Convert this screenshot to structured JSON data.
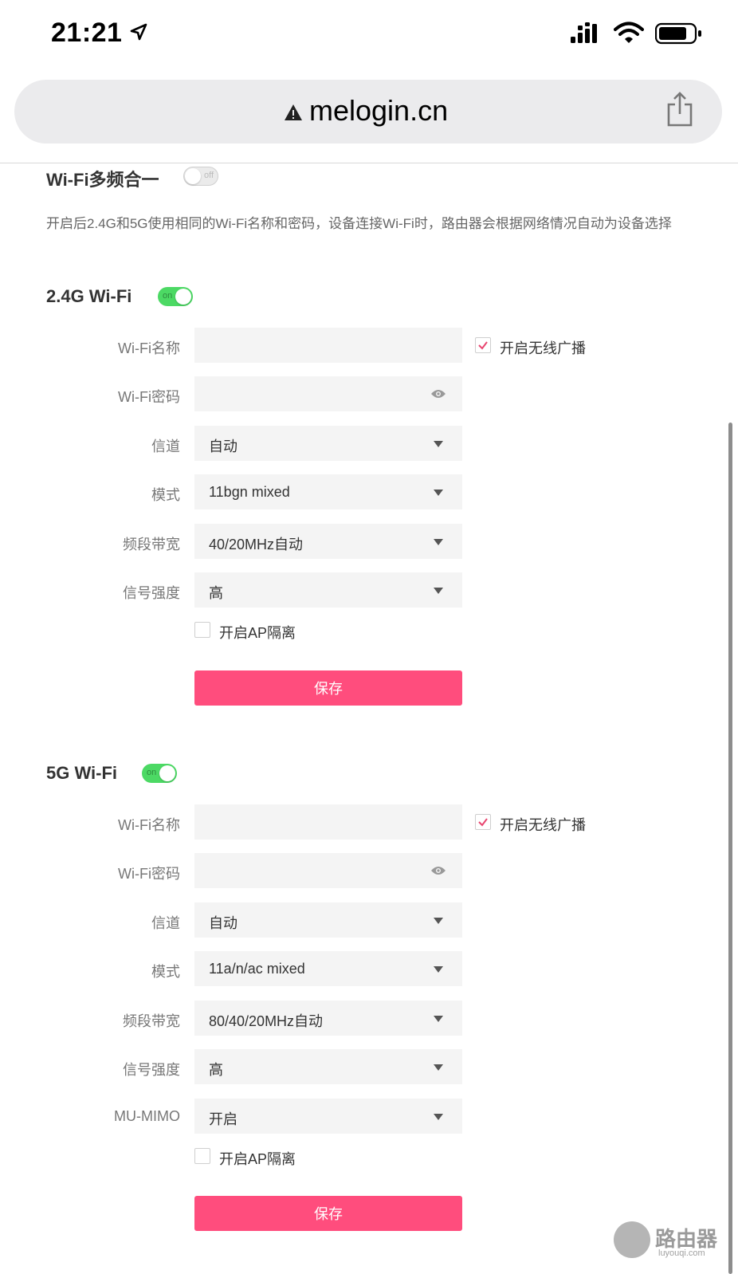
{
  "status_bar": {
    "time": "21:21"
  },
  "url_bar": {
    "url": "melogin.cn"
  },
  "multiband": {
    "title": "Wi-Fi多频合一",
    "toggle_label": "off",
    "description": "开启后2.4G和5G使用相同的Wi-Fi名称和密码，设备连接Wi-Fi时，路由器会根据网络情况自动为设备选择"
  },
  "wifi_24g": {
    "title": "2.4G Wi-Fi",
    "toggle_label": "on",
    "name_label": "Wi-Fi名称",
    "name_value": "",
    "broadcast_label": "开启无线广播",
    "password_label": "Wi-Fi密码",
    "password_value": "",
    "channel_label": "信道",
    "channel_value": "自动",
    "mode_label": "模式",
    "mode_value": "11bgn mixed",
    "bandwidth_label": "频段带宽",
    "bandwidth_value": "40/20MHz自动",
    "power_label": "信号强度",
    "power_value": "高",
    "ap_isolation_label": "开启AP隔离",
    "save_label": "保存"
  },
  "wifi_5g": {
    "title": "5G Wi-Fi",
    "toggle_label": "on",
    "name_label": "Wi-Fi名称",
    "name_value": "",
    "broadcast_label": "开启无线广播",
    "password_label": "Wi-Fi密码",
    "password_value": "",
    "channel_label": "信道",
    "channel_value": "自动",
    "mode_label": "模式",
    "mode_value": "11a/n/ac mixed",
    "bandwidth_label": "频段带宽",
    "bandwidth_value": "80/40/20MHz自动",
    "power_label": "信号强度",
    "power_value": "高",
    "mumimo_label": "MU-MIMO",
    "mumimo_value": "开启",
    "ap_isolation_label": "开启AP隔离",
    "save_label": "保存"
  },
  "watermark": {
    "text": "路由器",
    "sub": "luyouqi.com"
  },
  "colors": {
    "accent": "#ff4d7d",
    "toggle_on": "#4cd964",
    "check": "#e8456f"
  }
}
